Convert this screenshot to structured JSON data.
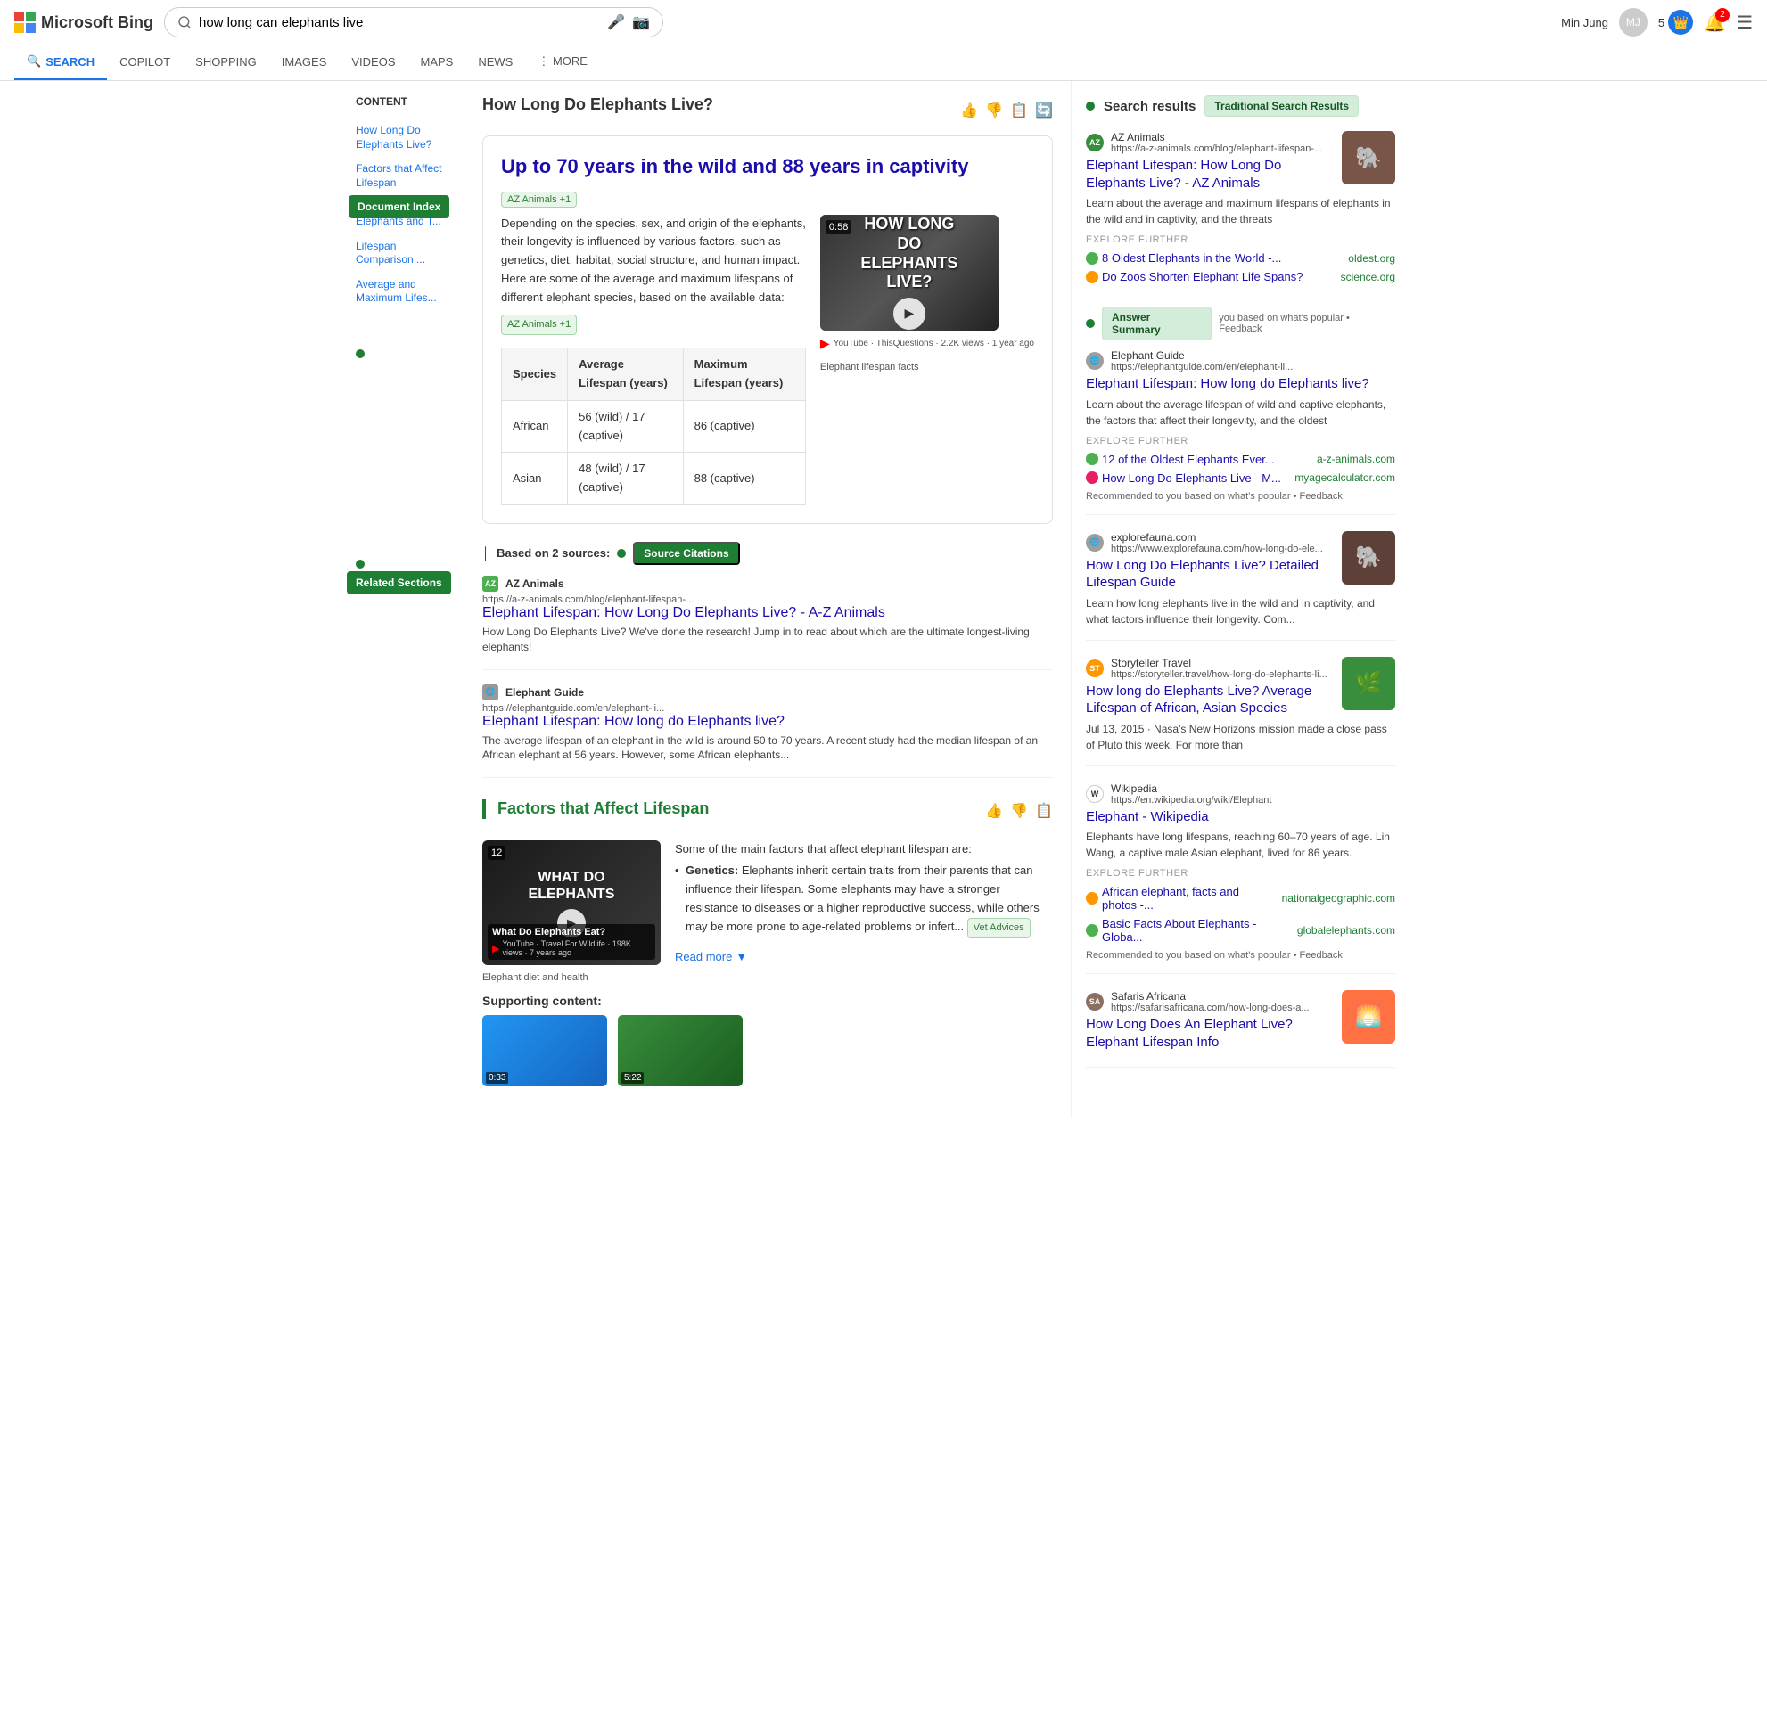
{
  "header": {
    "logo_text": "Microsoft Bing",
    "search_query": "how long can elephants live",
    "user_name": "Min Jung",
    "points": "5",
    "notif_count": "2"
  },
  "nav_tabs": [
    {
      "id": "search",
      "label": "SEARCH",
      "icon": "🔍",
      "active": true
    },
    {
      "id": "copilot",
      "label": "COPILOT",
      "icon": "",
      "active": false
    },
    {
      "id": "shopping",
      "label": "SHOPPING",
      "icon": "",
      "active": false
    },
    {
      "id": "images",
      "label": "IMAGES",
      "icon": "",
      "active": false
    },
    {
      "id": "videos",
      "label": "VIDEOS",
      "icon": "",
      "active": false
    },
    {
      "id": "maps",
      "label": "MAPS",
      "icon": "",
      "active": false
    },
    {
      "id": "news",
      "label": "NEWS",
      "icon": "",
      "active": false
    },
    {
      "id": "more",
      "label": "⋮ MORE",
      "icon": "",
      "active": false
    }
  ],
  "sidebar": {
    "title": "Content",
    "items": [
      {
        "label": "How Long Do Elephants Live?"
      },
      {
        "label": "Factors that Affect Lifespan"
      },
      {
        "label": "Oldest Known Elephants and T..."
      },
      {
        "label": "Lifespan Comparison ..."
      },
      {
        "label": "Average and Maximum Lifes..."
      }
    ],
    "doc_index_label": "Document Index",
    "related_sections_label": "Related Sections"
  },
  "main": {
    "page_title": "How Long Do Elephants Live?",
    "answer_heading": "Up to 70 years in the wild and 88 years in captivity",
    "az_badge": "AZ Animals +1",
    "answer_text": "Depending on the species, sex, and origin of the elephants, their longevity is influenced by various factors, such as genetics, diet, habitat, social structure, and human impact. Here are some of the average and maximum lifespans of different elephant species, based on the available data:",
    "elephant_facts_label": "Elephant lifespan facts",
    "video": {
      "duration": "0:58",
      "title": "HOW LONG DO ELEPHANTS LIVE?",
      "play_label": "▶",
      "meta": "How long do elephants live?",
      "source": "YouTube · ThisQuestions · 2.2K views · 1 year ago"
    },
    "table": {
      "headers": [
        "Species",
        "Average Lifespan (years)",
        "Maximum Lifespan (years)"
      ],
      "rows": [
        {
          "species": "African",
          "avg": "56 (wild) / 17 (captive)",
          "max": "86 (captive)"
        },
        {
          "species": "Asian",
          "avg": "48 (wild) / 17 (captive)",
          "max": "88 (captive)"
        }
      ]
    },
    "source_citations": {
      "label": "Based on 2 sources:",
      "btn_label": "Source Citations",
      "items": [
        {
          "site_name": "AZ Animals",
          "site_url": "https://a-z-animals.com/blog/elephant-lifespan-...",
          "title": "Elephant Lifespan: How Long Do Elephants Live? - A-Z Animals",
          "desc": "How Long Do Elephants Live? We've done the research! Jump in to read about which are the ultimate longest-living elephants!",
          "icon": "AZ"
        },
        {
          "site_name": "Elephant Guide",
          "site_url": "https://elephantguide.com/en/elephant-li...",
          "title": "Elephant Lifespan: How long do Elephants live?",
          "desc": "The average lifespan of an elephant in the wild is around 50 to 70 years. A recent study had the median lifespan of an African elephant at 56 years. However, some African elephants...",
          "icon": "EG"
        }
      ]
    },
    "factors_section": {
      "heading": "Factors that Affect Lifespan",
      "video": {
        "duration": "12",
        "title": "WHAT DO ELEPHANTS",
        "subtitle": "What Do Elephants Eat?",
        "source": "YouTube · Travel For Wildlife · 198K views · 7 years ago",
        "health_label": "Elephant diet and health"
      },
      "intro": "Some of the main factors that affect elephant lifespan are:",
      "genetics_text": "Genetics: Elephants inherit certain traits from their parents that can influence their lifespan. Some elephants may have a stronger resistance to diseases or a higher reproductive success, while others may be more prone to age-related problems or infert...",
      "vet_badge": "Vet Advices",
      "read_more": "Read more",
      "supporting_title": "Supporting content:"
    }
  },
  "right_panel": {
    "title": "Search results",
    "trad_results_label": "Traditional Search Results",
    "answer_summary_label": "Answer Summary",
    "results": [
      {
        "id": "az_animals",
        "site_name": "AZ Animals",
        "site_url": "https://a-z-animals.com/blog/elephant-lifespan-...",
        "title": "Elephant Lifespan: How Long Do Elephants Live? - AZ Animals",
        "desc": "Learn about the average and maximum lifespans of elephants in the wild and in captivity, and the threats",
        "explore_further": [
          {
            "label": "8 Oldest Elephants in the World -...",
            "source": "oldest.org",
            "icon_color": "#4caf50"
          },
          {
            "label": "Do Zoos Shorten Elephant Life Spans?",
            "source": "science.org",
            "icon_color": "#ff9800"
          }
        ],
        "icon_type": "animal",
        "has_thumb": true,
        "thumb_emoji": "🐘"
      },
      {
        "id": "elephant_guide",
        "site_name": "Elephant Guide",
        "site_url": "https://elephantguide.com/en/elephant-li...",
        "title": "Elephant Lifespan: How long do Elephants live?",
        "desc": "Learn about the average lifespan of wild and captive elephants, the factors that affect their longevity, and the oldest",
        "explore_further": [
          {
            "label": "12 of the Oldest Elephants Ever...",
            "source": "a-z-animals.com",
            "icon_color": "#4caf50"
          },
          {
            "label": "How Long Do Elephants Live - M...",
            "source": "myagecalculator.com",
            "icon_color": "#e91e63"
          }
        ],
        "recommended": "Recommended to you based on what's popular • Feedback",
        "icon_type": "gray",
        "has_thumb": false
      },
      {
        "id": "explorefauna",
        "site_name": "explorefauna.com",
        "site_url": "https://www.explorefauna.com/how-long-do-ele...",
        "title": "How Long Do Elephants Live? Detailed Lifespan Guide",
        "desc": "Learn how long elephants live in the wild and in captivity, and what factors influence their longevity. Com...",
        "icon_type": "gray",
        "has_thumb": true,
        "thumb_emoji": "🐘"
      },
      {
        "id": "storyteller",
        "site_name": "Storyteller Travel",
        "site_url": "https://storyteller.travel/how-long-do-elephants-li...",
        "title": "How long do Elephants Live? Average Lifespan of African, Asian Species",
        "desc": "Jul 13, 2015 · Nasa's New Horizons mission made a close pass of Pluto this week. For more than",
        "icon_type": "story",
        "icon_label": "ST",
        "has_thumb": true,
        "thumb_emoji": "🌿"
      },
      {
        "id": "wikipedia",
        "site_name": "Wikipedia",
        "site_url": "https://en.wikipedia.org/wiki/Elephant",
        "title": "Elephant - Wikipedia",
        "desc": "Elephants have long lifespans, reaching 60–70 years of age. Lin Wang, a captive male Asian elephant, lived for 86 years.",
        "explore_further": [
          {
            "label": "African elephant, facts and photos -...",
            "source": "nationalgeographic.com",
            "icon_color": "#ff9800"
          },
          {
            "label": "Basic Facts About Elephants - Globa...",
            "source": "globalelephants.com",
            "icon_color": "#4caf50"
          }
        ],
        "recommended": "Recommended to you based on what's popular • Feedback",
        "icon_type": "wiki",
        "icon_label": "W",
        "has_thumb": false
      },
      {
        "id": "safaris",
        "site_name": "Safaris Africana",
        "site_url": "https://safarisafricana.com/how-long-does-a...",
        "title": "How Long Does An Elephant Live? Elephant Lifespan Info",
        "desc": "",
        "icon_type": "safari",
        "icon_label": "SA",
        "has_thumb": true,
        "thumb_emoji": "🌅"
      }
    ]
  }
}
